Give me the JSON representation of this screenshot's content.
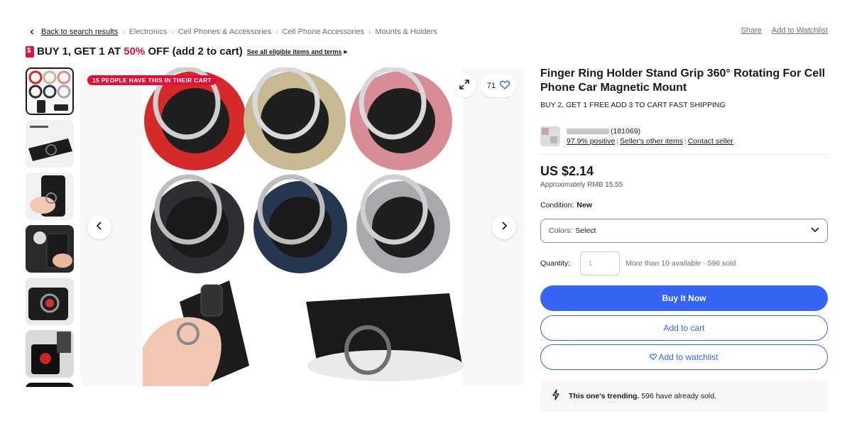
{
  "breadcrumb": {
    "back_label": "Back to search results",
    "items": [
      "Electronics",
      "Cell Phones & Accessories",
      "Cell Phone Accessories",
      "Mounts & Holders"
    ]
  },
  "top_actions": {
    "share": "Share",
    "watchlist": "Add to Watchlist"
  },
  "promo": {
    "prefix": "BUY 1, GET 1 AT ",
    "highlight": "50%",
    "suffix": " OFF (add 2 to cart)",
    "link": "See all eligible items and terms"
  },
  "gallery": {
    "thumbnail_count": 7,
    "badge": "15 PEOPLE HAVE THIS IN THEIR CART",
    "watch_count": "71",
    "ring_colors": [
      "#d42a2a",
      "#c7ba93",
      "#d88d96",
      "#2f2f33",
      "#26364f",
      "#a7a9ac"
    ]
  },
  "product": {
    "title": "Finger Ring Holder Stand Grip 360° Rotating For Cell Phone Car Magnetic Mount",
    "subtitle": "BUY 2, GET 1 FREE ADD 3 TO CART FAST SHIPPING",
    "seller_feedback_count": "(181069)",
    "seller_positive": "97.9% positive",
    "seller_other_items": "Seller's other items",
    "contact_seller": "Contact seller",
    "price": "US $2.14",
    "approx_price": "Approximately RMB 15.55",
    "condition_label": "Condition:",
    "condition_value": "New",
    "colors_label": "Colors:",
    "colors_value": "Select",
    "quantity_label": "Quantity:",
    "quantity_value": "1",
    "availability": "More than 10 available · 596 sold",
    "buy_now": "Buy It Now",
    "add_to_cart": "Add to cart",
    "add_to_watchlist": "Add to watchlist",
    "trend_bold": "This one's trending.",
    "trend_text": "596 have already sold."
  },
  "colors": {
    "accent": "#3665f3",
    "promo_red": "#e0103a"
  }
}
